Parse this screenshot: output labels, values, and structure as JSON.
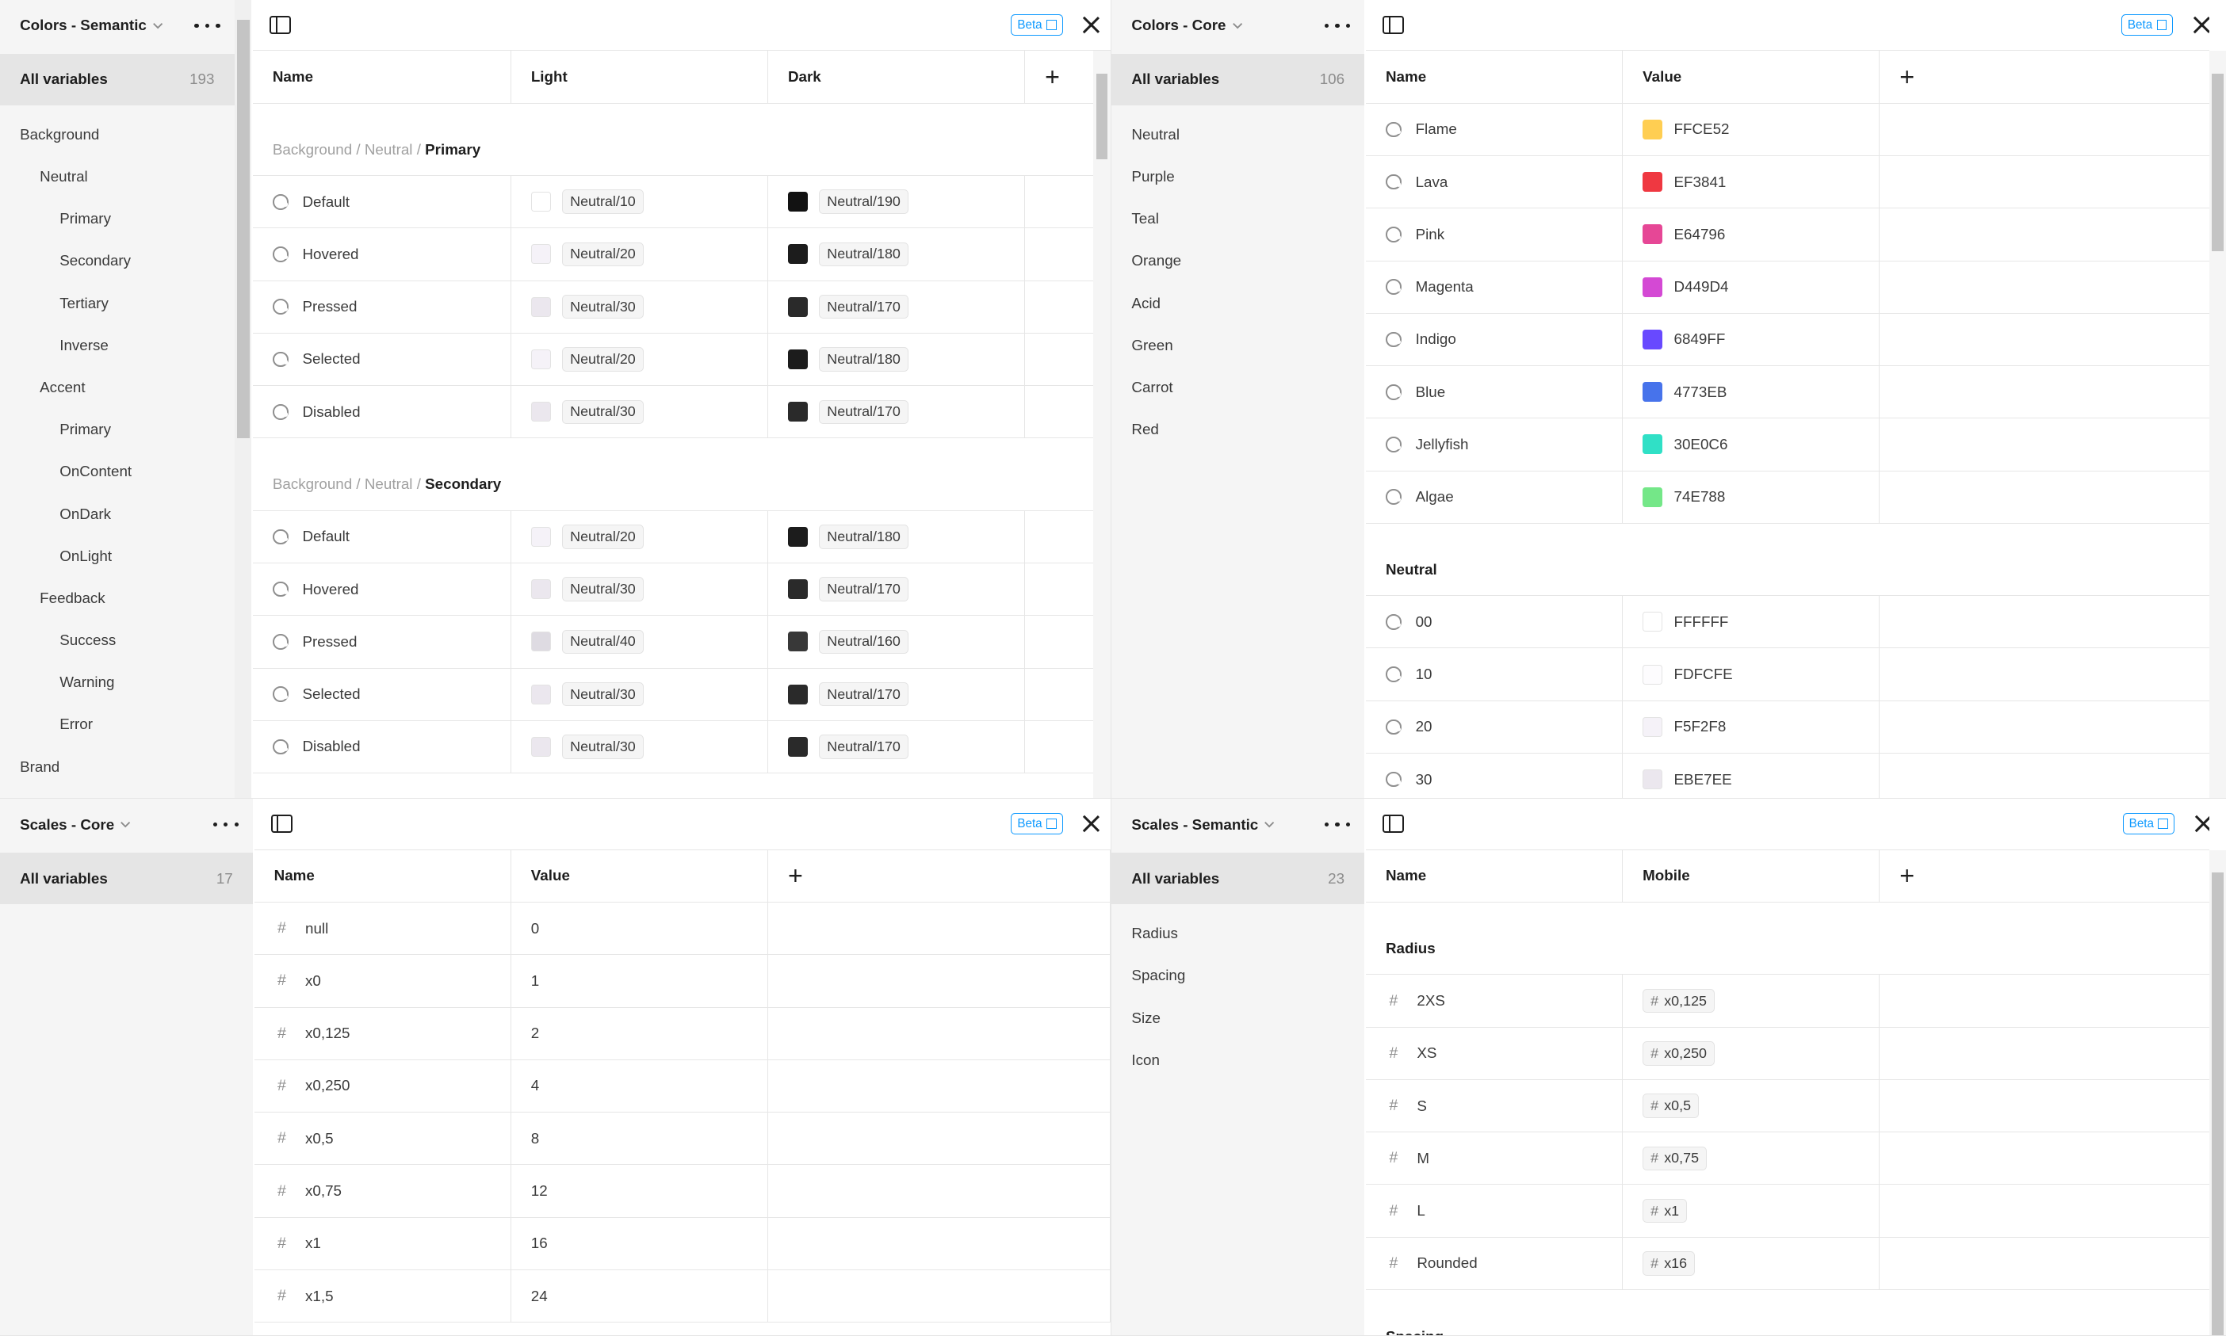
{
  "colors_semantic": {
    "title": "Colors - Semantic",
    "all_variables": "All variables",
    "count": "193",
    "groups": [
      {
        "label": "Background",
        "level": 0
      },
      {
        "label": "Neutral",
        "level": 1
      },
      {
        "label": "Primary",
        "level": 2
      },
      {
        "label": "Secondary",
        "level": 2
      },
      {
        "label": "Tertiary",
        "level": 2
      },
      {
        "label": "Inverse",
        "level": 2
      },
      {
        "label": "Accent",
        "level": 1
      },
      {
        "label": "Primary",
        "level": 2
      },
      {
        "label": "OnContent",
        "level": 2
      },
      {
        "label": "OnDark",
        "level": 2
      },
      {
        "label": "OnLight",
        "level": 2
      },
      {
        "label": "Feedback",
        "level": 1
      },
      {
        "label": "Success",
        "level": 2
      },
      {
        "label": "Warning",
        "level": 2
      },
      {
        "label": "Error",
        "level": 2
      },
      {
        "label": "Brand",
        "level": 0
      }
    ],
    "beta": "Beta",
    "columns": [
      "Name",
      "Light",
      "Dark"
    ],
    "sections": [
      {
        "crumb1": "Background",
        "crumb2": "Neutral",
        "name": "Primary",
        "rows": [
          {
            "name": "Default",
            "light": "Neutral/10",
            "light_color": "#ffffff",
            "dark": "Neutral/190",
            "dark_color": "#121212"
          },
          {
            "name": "Hovered",
            "light": "Neutral/20",
            "light_color": "#f5f2f8",
            "dark": "Neutral/180",
            "dark_color": "#1c1c1c"
          },
          {
            "name": "Pressed",
            "light": "Neutral/30",
            "light_color": "#ebe7ee",
            "dark": "Neutral/170",
            "dark_color": "#2a2a2a"
          },
          {
            "name": "Selected",
            "light": "Neutral/20",
            "light_color": "#f5f2f8",
            "dark": "Neutral/180",
            "dark_color": "#1c1c1c"
          },
          {
            "name": "Disabled",
            "light": "Neutral/30",
            "light_color": "#ebe7ee",
            "dark": "Neutral/170",
            "dark_color": "#2a2a2a"
          }
        ]
      },
      {
        "crumb1": "Background",
        "crumb2": "Neutral",
        "name": "Secondary",
        "rows": [
          {
            "name": "Default",
            "light": "Neutral/20",
            "light_color": "#f5f2f8",
            "dark": "Neutral/180",
            "dark_color": "#1c1c1c"
          },
          {
            "name": "Hovered",
            "light": "Neutral/30",
            "light_color": "#ebe7ee",
            "dark": "Neutral/170",
            "dark_color": "#2a2a2a"
          },
          {
            "name": "Pressed",
            "light": "Neutral/40",
            "light_color": "#dedbe2",
            "dark": "Neutral/160",
            "dark_color": "#383838"
          },
          {
            "name": "Selected",
            "light": "Neutral/30",
            "light_color": "#ebe7ee",
            "dark": "Neutral/170",
            "dark_color": "#2a2a2a"
          },
          {
            "name": "Disabled",
            "light": "Neutral/30",
            "light_color": "#ebe7ee",
            "dark": "Neutral/170",
            "dark_color": "#2a2a2a"
          }
        ]
      }
    ]
  },
  "colors_core": {
    "title": "Colors - Core",
    "all_variables": "All variables",
    "count": "106",
    "groups": [
      "Neutral",
      "Purple",
      "Teal",
      "Orange",
      "Acid",
      "Green",
      "Carrot",
      "Red"
    ],
    "beta": "Beta",
    "columns": [
      "Name",
      "Value"
    ],
    "rows": [
      {
        "name": "Flame",
        "value": "FFCE52",
        "color": "#FFCE52"
      },
      {
        "name": "Lava",
        "value": "EF3841",
        "color": "#EF3841"
      },
      {
        "name": "Pink",
        "value": "E64796",
        "color": "#E64796"
      },
      {
        "name": "Magenta",
        "value": "D449D4",
        "color": "#D449D4"
      },
      {
        "name": "Indigo",
        "value": "6849FF",
        "color": "#6849FF"
      },
      {
        "name": "Blue",
        "value": "4773EB",
        "color": "#4773EB"
      },
      {
        "name": "Jellyfish",
        "value": "30E0C6",
        "color": "#30E0C6"
      },
      {
        "name": "Algae",
        "value": "74E788",
        "color": "#74E788"
      }
    ],
    "neutral_section": "Neutral",
    "neutral_rows": [
      {
        "name": "00",
        "value": "FFFFFF",
        "color": "#FFFFFF"
      },
      {
        "name": "10",
        "value": "FDFCFE",
        "color": "#FDFCFE"
      },
      {
        "name": "20",
        "value": "F5F2F8",
        "color": "#F5F2F8"
      },
      {
        "name": "30",
        "value": "EBE7EE",
        "color": "#EBE7EE"
      }
    ]
  },
  "scales_core": {
    "title": "Scales - Core",
    "all_variables": "All variables",
    "count": "17",
    "beta": "Beta",
    "columns": [
      "Name",
      "Value"
    ],
    "rows": [
      {
        "name": "null",
        "value": "0"
      },
      {
        "name": "x0",
        "value": "1"
      },
      {
        "name": "x0,125",
        "value": "2"
      },
      {
        "name": "x0,250",
        "value": "4"
      },
      {
        "name": "x0,5",
        "value": "8"
      },
      {
        "name": "x0,75",
        "value": "12"
      },
      {
        "name": "x1",
        "value": "16"
      },
      {
        "name": "x1,5",
        "value": "24"
      }
    ]
  },
  "scales_semantic": {
    "title": "Scales - Semantic",
    "all_variables": "All variables",
    "count": "23",
    "groups": [
      "Radius",
      "Spacing",
      "Size",
      "Icon"
    ],
    "beta": "Beta",
    "columns": [
      "Name",
      "Mobile"
    ],
    "section": "Radius",
    "rows": [
      {
        "name": "2XS",
        "value": "x0,125"
      },
      {
        "name": "XS",
        "value": "x0,250"
      },
      {
        "name": "S",
        "value": "x0,5"
      },
      {
        "name": "M",
        "value": "x0,75"
      },
      {
        "name": "L",
        "value": "x1"
      },
      {
        "name": "Rounded",
        "value": "x16"
      }
    ],
    "next_section": "Spacing"
  },
  "colors": {
    "accent": "#0d99ff",
    "sidebar_bg": "#f5f5f5",
    "divider": "#e6e6e6"
  }
}
